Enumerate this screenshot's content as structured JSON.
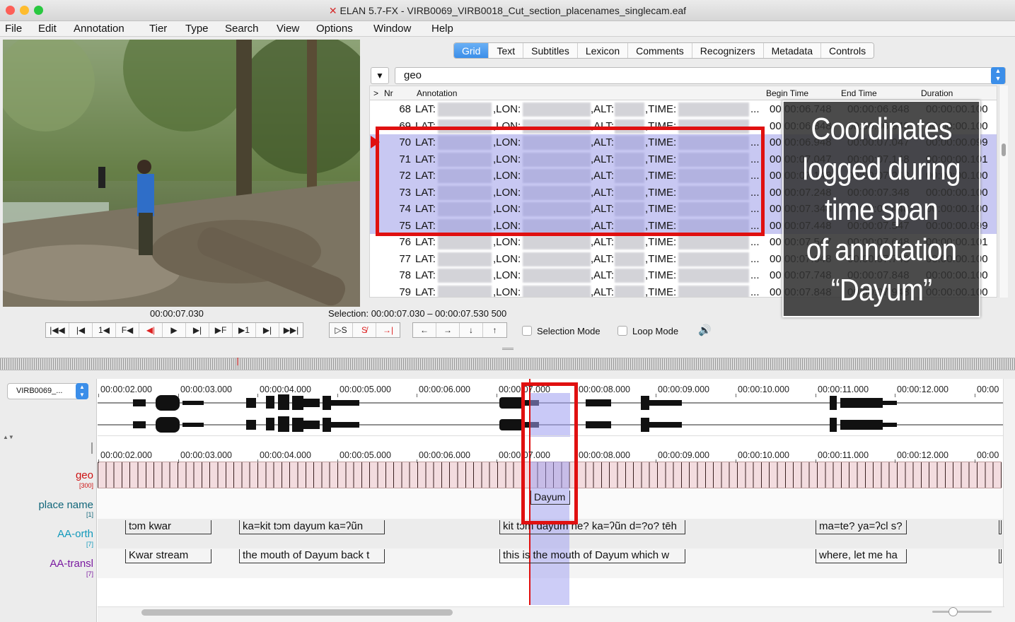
{
  "window": {
    "title": "ELAN 5.7-FX - VIRB0069_VIRB0018_Cut_section_placenames_singlecam.eaf",
    "colors": {
      "close": "#fd5f57",
      "minimize": "#febc2e",
      "maximize": "#29c840",
      "accent": "#3b8ee9",
      "selection": "#c8c8f2",
      "highlight": "#e01010"
    }
  },
  "menu": [
    "File",
    "Edit",
    "Annotation",
    "Tier",
    "Type",
    "Search",
    "View",
    "Options",
    "Window",
    "Help"
  ],
  "tabs": [
    "Grid",
    "Text",
    "Subtitles",
    "Lexicon",
    "Comments",
    "Recognizers",
    "Metadata",
    "Controls"
  ],
  "grid": {
    "tier": "geo",
    "headers": {
      "marker": ">",
      "nr": "Nr",
      "annotation": "Annotation",
      "begin": "Begin Time",
      "end": "End Time",
      "duration": "Duration"
    },
    "rows": [
      {
        "nr": "68",
        "lat": "LAT:",
        "lon": ",LON:",
        "alt": ",ALT:",
        "time": ",TIME:",
        "more": "...",
        "begin": "00:00:06.748",
        "end": "00:00:06.848",
        "dur": "00:00:00.100",
        "selected": false
      },
      {
        "nr": "69",
        "lat": "LAT:",
        "lon": ",LON:",
        "alt": ",ALT:",
        "time": ",TIME:",
        "more": "...",
        "begin": "00:00:06.848",
        "end": "00:00:06.948",
        "dur": "00:00:00.100",
        "selected": false
      },
      {
        "nr": "70",
        "lat": "LAT:",
        "lon": ",LON:",
        "alt": ",ALT:",
        "time": ",TIME:",
        "more": "...",
        "begin": "00:00:06.948",
        "end": "00:00:07.047",
        "dur": "00:00:00.099",
        "selected": true
      },
      {
        "nr": "71",
        "lat": "LAT:",
        "lon": ",LON:",
        "alt": ",ALT:",
        "time": ",TIME:",
        "more": "...",
        "begin": "00:00:07.047",
        "end": "00:00:07.148",
        "dur": "00:00:00.101",
        "selected": true
      },
      {
        "nr": "72",
        "lat": "LAT:",
        "lon": ",LON:",
        "alt": ",ALT:",
        "time": ",TIME:",
        "more": "...",
        "begin": "00:00:07.148",
        "end": "00:00:07.248",
        "dur": "00:00:00.100",
        "selected": true
      },
      {
        "nr": "73",
        "lat": "LAT:",
        "lon": ",LON:",
        "alt": ",ALT:",
        "time": ",TIME:",
        "more": "...",
        "begin": "00:00:07.248",
        "end": "00:00:07.348",
        "dur": "00:00:00.100",
        "selected": true
      },
      {
        "nr": "74",
        "lat": "LAT:",
        "lon": ",LON:",
        "alt": ",ALT:",
        "time": ",TIME:",
        "more": "...",
        "begin": "00:00:07.348",
        "end": "00:00:07.448",
        "dur": "00:00:00.100",
        "selected": true
      },
      {
        "nr": "75",
        "lat": "LAT:",
        "lon": ",LON:",
        "alt": ",ALT:",
        "time": ",TIME:",
        "more": "...",
        "begin": "00:00:07.448",
        "end": "00:00:07.547",
        "dur": "00:00:00.099",
        "selected": true
      },
      {
        "nr": "76",
        "lat": "LAT:",
        "lon": ",LON:",
        "alt": ",ALT:",
        "time": ",TIME:",
        "more": "...",
        "begin": "00:00:07.547",
        "end": "00:00:07.648",
        "dur": "00:00:00.101",
        "selected": false
      },
      {
        "nr": "77",
        "lat": "LAT:",
        "lon": ",LON:",
        "alt": ",ALT:",
        "time": ",TIME:",
        "more": "...",
        "begin": "00:00:07.648",
        "end": "00:00:07.748",
        "dur": "00:00:00.100",
        "selected": false
      },
      {
        "nr": "78",
        "lat": "LAT:",
        "lon": ",LON:",
        "alt": ",ALT:",
        "time": ",TIME:",
        "more": "...",
        "begin": "00:00:07.748",
        "end": "00:00:07.848",
        "dur": "00:00:00.100",
        "selected": false
      },
      {
        "nr": "79",
        "lat": "LAT:",
        "lon": ",LON:",
        "alt": ",ALT:",
        "time": ",TIME:",
        "more": "...",
        "begin": "00:00:07.848",
        "end": "00:00:07.948",
        "dur": "00:00:00.100",
        "selected": false
      }
    ]
  },
  "overlay": {
    "lines": [
      "Coordinates",
      "logged during",
      "time span",
      "of annotation",
      "“Dayum”"
    ]
  },
  "player": {
    "current_time": "00:00:07.030",
    "selection": "Selection: 00:00:07.030 – 00:00:07.530  500",
    "play_buttons": [
      "|◀◀",
      "|◀",
      "1◀",
      "F◀",
      "◀|",
      "▶",
      "▶|",
      "▶F",
      "▶1",
      "▶|",
      "▶▶|"
    ],
    "sel_buttons": [
      "▷S",
      "S̸",
      "→|"
    ],
    "nav_buttons": [
      "←",
      "→",
      "↓",
      "↑"
    ],
    "selection_mode_label": "Selection Mode",
    "loop_mode_label": "Loop Mode",
    "volume_icon": "speaker-icon"
  },
  "timeline": {
    "media_file": "VIRB0069_...",
    "ticks": [
      "00:00:02.000",
      "00:00:03.000",
      "00:00:04.000",
      "00:00:05.000",
      "00:00:06.000",
      "00:00:07.000",
      "00:00:08.000",
      "00:00:09.000",
      "00:00:10.000",
      "00:00:11.000",
      "00:00:12.000",
      "00:00"
    ],
    "tiers": [
      {
        "name": "geo",
        "count": "[300]",
        "color": "#cc1111"
      },
      {
        "name": "place name",
        "count": "[1]",
        "color": "#11667a"
      },
      {
        "name": "AA-orth",
        "count": "[7]",
        "color": "#1199bb"
      },
      {
        "name": "AA-transl",
        "count": "[7]",
        "color": "#7a1aa0"
      }
    ],
    "place_annotation": "Dayum",
    "orth": [
      "tɔm kwar",
      "ka=kit tɔm dayum ka=ʔũn",
      "kit tɔm dayum ne? ka=ʔũn d=?o? tēh",
      "ma=te? ya=ʔcl s?"
    ],
    "transl": [
      "Kwar stream",
      "the mouth of Dayum back t",
      "this is the mouth of Dayum which w",
      "where, let me ha"
    ]
  }
}
